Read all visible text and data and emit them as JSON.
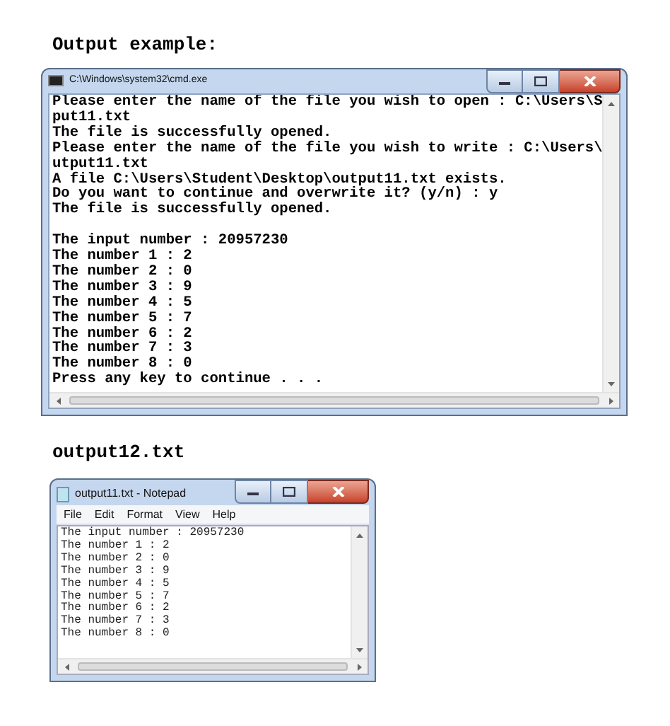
{
  "output_heading": "Output example:",
  "console_window": {
    "title": "C:\\Windows\\system32\\cmd.exe",
    "line_groups": [
      [
        "Please enter the name of the file you wish to open : C:\\Users\\S",
        "put11.txt",
        "The file is successfully opened.",
        "Please enter the name of the file you wish to write : C:\\Users\\",
        "utput11.txt",
        "A file C:\\Users\\Student\\Desktop\\output11.txt exists.",
        "Do you want to continue and overwrite it? (y/n) : y",
        "The file is successfully opened."
      ],
      [
        "The input number : 20957230",
        "The number 1 : 2",
        "The number 2 : 0",
        "The number 3 : 9",
        "The number 4 : 5",
        "The number 5 : 7",
        "The number 6 : 2",
        "The number 7 : 3",
        "The number 8 : 0",
        "Press any key to continue . . ."
      ]
    ]
  },
  "file_heading": "output12.txt",
  "notepad_window": {
    "title": "output11.txt - Notepad",
    "menu": [
      "File",
      "Edit",
      "Format",
      "View",
      "Help"
    ],
    "lines": [
      "The input number : 20957230",
      "The number 1 : 2",
      "The number 2 : 0",
      "The number 3 : 9",
      "The number 4 : 5",
      "The number 5 : 7",
      "The number 6 : 2",
      "The number 7 : 3",
      "The number 8 : 0"
    ]
  }
}
